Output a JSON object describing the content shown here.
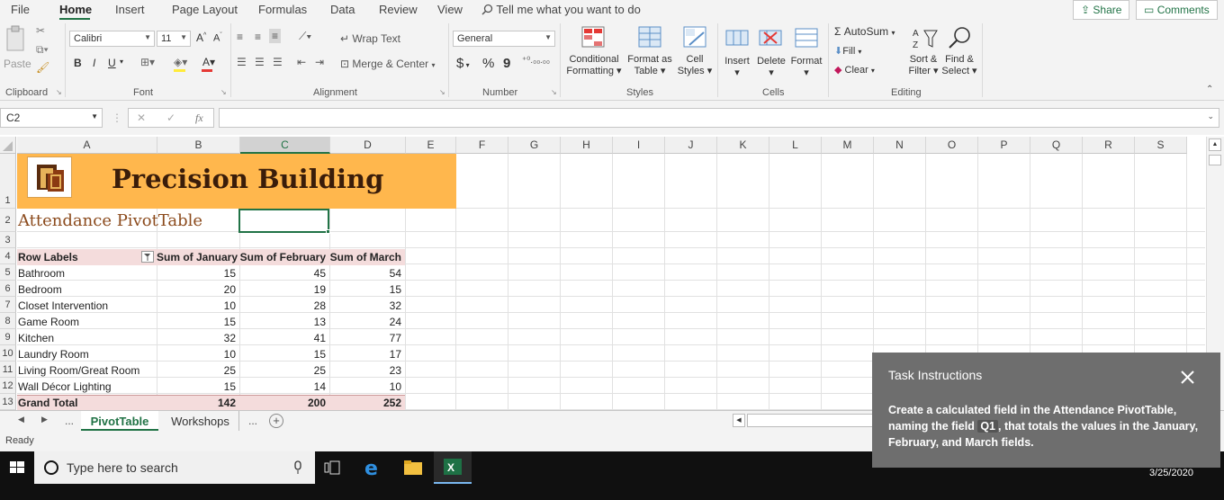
{
  "menu": {
    "file": "File",
    "home": "Home",
    "insert": "Insert",
    "page_layout": "Page Layout",
    "formulas": "Formulas",
    "data": "Data",
    "review": "Review",
    "view": "View",
    "tell_me": "Tell me what you want to do",
    "share": "Share",
    "comments": "Comments"
  },
  "ribbon": {
    "clipboard": {
      "paste": "Paste",
      "label": "Clipboard"
    },
    "font": {
      "name": "Calibri",
      "size": "11",
      "grow": "A",
      "shrink": "A",
      "bold": "B",
      "italic": "I",
      "underline": "U",
      "label": "Font"
    },
    "alignment": {
      "wrap_text": "Wrap Text",
      "merge_center": "Merge & Center",
      "label": "Alignment"
    },
    "number": {
      "format": "General",
      "currency": "$",
      "percent": "%",
      "comma": "9",
      "label": "Number"
    },
    "styles": {
      "conditional_1": "Conditional",
      "conditional_2": "Formatting",
      "format_as_1": "Format as",
      "format_as_2": "Table",
      "cell_styles_1": "Cell",
      "cell_styles_2": "Styles",
      "label": "Styles"
    },
    "cells": {
      "insert": "Insert",
      "delete": "Delete",
      "format": "Format",
      "label": "Cells"
    },
    "editing": {
      "autosum": "AutoSum",
      "fill": "Fill",
      "clear": "Clear",
      "sort_1": "Sort &",
      "sort_2": "Filter",
      "find_1": "Find &",
      "find_2": "Select",
      "label": "Editing"
    }
  },
  "formula_bar": {
    "name_box": "C2",
    "cancel": "✕",
    "enter": "✓",
    "fx": "fx",
    "content": ""
  },
  "columns": [
    "A",
    "B",
    "C",
    "D",
    "E",
    "F",
    "G",
    "H",
    "I",
    "J",
    "K",
    "L",
    "M",
    "N",
    "O",
    "P",
    "Q",
    "R",
    "S"
  ],
  "rows": [
    "1",
    "2",
    "3",
    "4",
    "5",
    "6",
    "7",
    "8",
    "9",
    "10",
    "11",
    "12",
    "13"
  ],
  "sheet": {
    "banner_title": "Precision Building",
    "subtitle": "Attendance PivotTable",
    "pivot_headers": [
      "Row Labels",
      "Sum of January",
      "Sum of February",
      "Sum of March"
    ],
    "pivot_rows": [
      {
        "label": "Bathroom",
        "jan": "15",
        "feb": "45",
        "mar": "54"
      },
      {
        "label": "Bedroom",
        "jan": "20",
        "feb": "19",
        "mar": "15"
      },
      {
        "label": "Closet Intervention",
        "jan": "10",
        "feb": "28",
        "mar": "32"
      },
      {
        "label": "Game Room",
        "jan": "15",
        "feb": "13",
        "mar": "24"
      },
      {
        "label": "Kitchen",
        "jan": "32",
        "feb": "41",
        "mar": "77"
      },
      {
        "label": "Laundry Room",
        "jan": "10",
        "feb": "15",
        "mar": "17"
      },
      {
        "label": "Living Room/Great Room",
        "jan": "25",
        "feb": "25",
        "mar": "23"
      },
      {
        "label": "Wall Décor Lighting",
        "jan": "15",
        "feb": "14",
        "mar": "10"
      }
    ],
    "grand_total": {
      "label": "Grand Total",
      "jan": "142",
      "feb": "200",
      "mar": "252"
    }
  },
  "tabs": {
    "ellipsis_left": "...",
    "active": "PivotTable",
    "other": "Workshops",
    "ellipsis_right": "...",
    "add": "+"
  },
  "status": {
    "ready": "Ready"
  },
  "taskbar": {
    "search_placeholder": "Type here to search",
    "date": "3/25/2020"
  },
  "task": {
    "title": "Task Instructions",
    "text_before": "Create a calculated field in the Attendance PivotTable, naming the field ",
    "field_name": "Q1",
    "text_after": ", that totals the values in the January, February, and March fields."
  },
  "colors": {
    "accent": "#217346",
    "banner": "#ffb74d",
    "pivot_header": "#f4dcdc",
    "subtitle": "#8b4a1c"
  }
}
